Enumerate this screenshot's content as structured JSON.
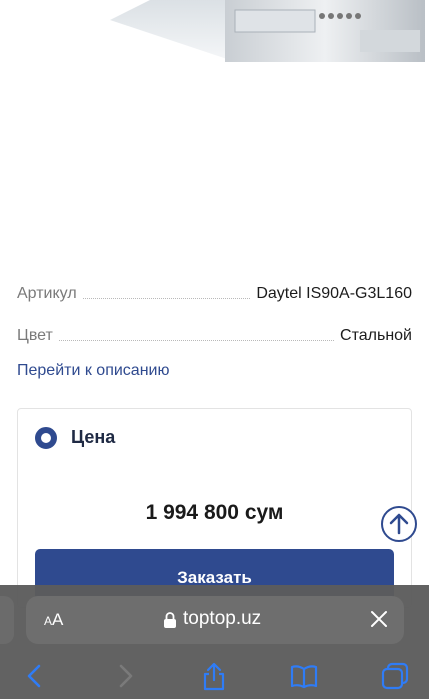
{
  "specs": {
    "article_label": "Артикул",
    "article_value": "Daytel IS90A-G3L160",
    "color_label": "Цвет",
    "color_value": "Стальной"
  },
  "goto_description": "Перейти к описанию",
  "price_card": {
    "title": "Цена",
    "price": "1 994 800 сум",
    "order_button": "Заказать"
  },
  "browser": {
    "text_size_small": "A",
    "text_size_large": "A",
    "url": "toptop.uz"
  },
  "colors": {
    "accent": "#2f4a8f",
    "browser_bar": "#5c5c5c"
  },
  "icons": [
    "lock-icon",
    "close-icon",
    "back-icon",
    "forward-icon",
    "share-icon",
    "bookmarks-icon",
    "tabs-icon",
    "arrow-up-icon"
  ]
}
